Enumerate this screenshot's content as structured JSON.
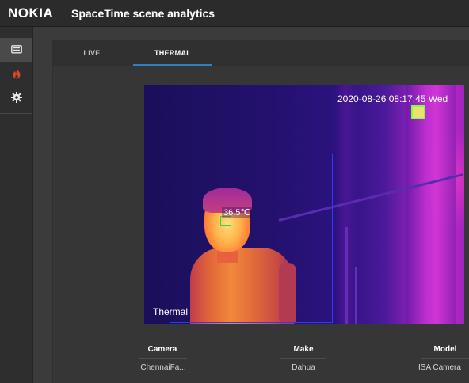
{
  "header": {
    "brand": "NOKIA",
    "title": "SpaceTime scene analytics"
  },
  "rail": {
    "items": [
      {
        "icon": "message-icon",
        "active": true
      },
      {
        "icon": "flame-icon",
        "active": false
      },
      {
        "icon": "gear-icon",
        "active": false
      }
    ]
  },
  "tabs": {
    "live": "LIVE",
    "thermal": "THERMAL",
    "active": "thermal"
  },
  "feed": {
    "timestamp": "2020-08-26 08:17:45 Wed",
    "temperature": "36.5℃",
    "stream_label": "Thermal"
  },
  "info": {
    "headers": [
      "Camera",
      "Make",
      "Model"
    ],
    "values": [
      "ChennaiFa...",
      "Dahua",
      "ISA Camera"
    ]
  },
  "colors": {
    "accent": "#2f7fc1",
    "flame": "#e0452c",
    "detection_box": "#2a3bff",
    "face_box": "#3fd04f"
  }
}
